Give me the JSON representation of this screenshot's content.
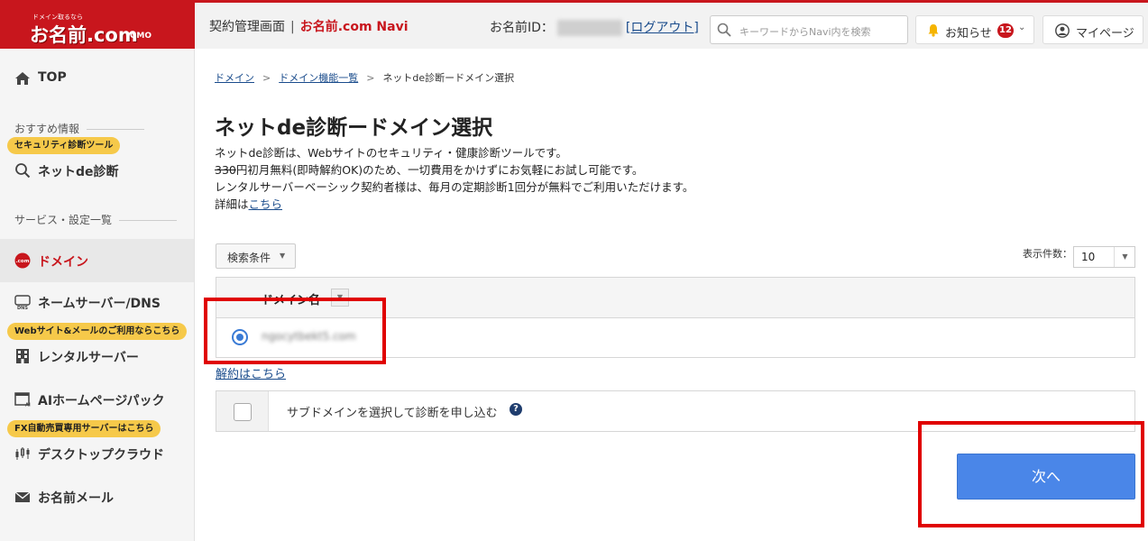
{
  "logo": {
    "tagline": "ドメイン取るなら",
    "name": "お名前.com",
    "gmo": "GMO"
  },
  "header": {
    "section": "契約管理画面",
    "separator": "|",
    "brand": "お名前.com Navi",
    "id_label": "お名前ID：",
    "logout_label": "[ログアウト]",
    "search_placeholder": "キーワードからNavi内を検索",
    "notice_label": "お知らせ",
    "notice_count": "12",
    "mypage_label": "マイページ"
  },
  "sidebar": {
    "top": "TOP",
    "recommend_section": "おすすめ情報",
    "security_pill": "セキュリティ診断ツール",
    "netde": "ネットde診断",
    "services_section": "サービス・設定一覧",
    "domain": "ドメイン",
    "nameserver": "ネームサーバー/DNS",
    "web_pill": "Webサイト&メールのご利用ならこちら",
    "rental": "レンタルサーバー",
    "ai": "AIホームページパック",
    "fx_pill": "FX自動売買専用サーバーはこちら",
    "desktop": "デスクトップクラウド",
    "mail": "お名前メール"
  },
  "breadcrumb": {
    "item1": "ドメイン",
    "item2": "ドメイン機能一覧",
    "current": "ネットde診断ードメイン選択",
    "sep": ">"
  },
  "page": {
    "title": "ネットde診断ードメイン選択",
    "line1": "ネットde診断は、Webサイトのセキュリティ・健康診断ツールです。",
    "line2_strike": "330",
    "line2_rest": "円初月無料(即時解約OK)のため、一切費用をかけずにお気軽にお試し可能です。",
    "line3": "レンタルサーバーベーシック契約者様は、毎月の定期診断1回分が無料でご利用いただけます。",
    "line4_prefix": "詳細は",
    "line4_link": "こちら"
  },
  "filters": {
    "condition_label": "検索条件",
    "per_page_label": "表示件数：",
    "per_page_value": "10"
  },
  "table": {
    "header_domain": "ドメイン名",
    "rows": [
      {
        "domain": "ngocytbekt5.com",
        "selected": true
      }
    ]
  },
  "cancel_link": "解約はこちら",
  "subdomain": {
    "label": "サブドメインを選択して診断を申し込む",
    "help": "?"
  },
  "next_button": "次へ",
  "colors": {
    "brand_red": "#c8161d",
    "accent_blue": "#4a86e8",
    "pill_yellow": "#f6c94a",
    "annotation_red": "#e00000"
  }
}
